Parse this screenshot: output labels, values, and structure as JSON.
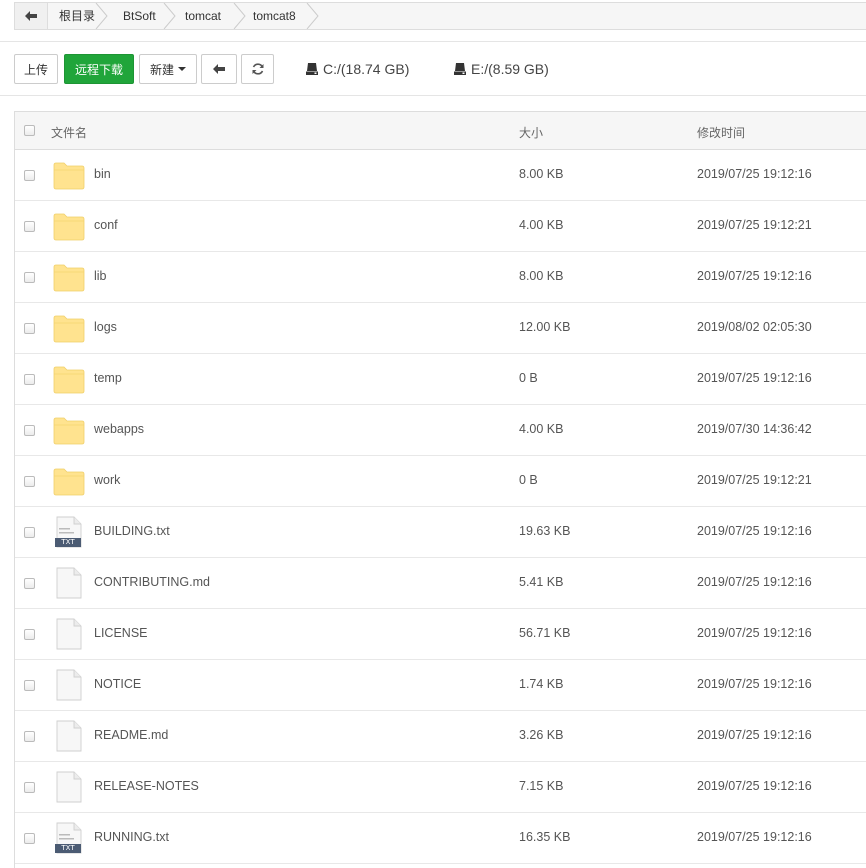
{
  "breadcrumb": {
    "items": [
      "根目录",
      "BtSoft",
      "tomcat",
      "tomcat8"
    ]
  },
  "toolbar": {
    "upload_label": "上传",
    "remote_download_label": "远程下载",
    "new_label": "新建",
    "disks": [
      {
        "label": "C:/(18.74 GB)"
      },
      {
        "label": "E:/(8.59 GB)"
      }
    ]
  },
  "table": {
    "headers": {
      "name": "文件名",
      "size": "大小",
      "mtime": "修改时间"
    },
    "rows": [
      {
        "type": "folder",
        "name": "bin",
        "size": "8.00 KB",
        "mtime": "2019/07/25 19:12:16"
      },
      {
        "type": "folder",
        "name": "conf",
        "size": "4.00 KB",
        "mtime": "2019/07/25 19:12:21"
      },
      {
        "type": "folder",
        "name": "lib",
        "size": "8.00 KB",
        "mtime": "2019/07/25 19:12:16"
      },
      {
        "type": "folder",
        "name": "logs",
        "size": "12.00 KB",
        "mtime": "2019/08/02 02:05:30"
      },
      {
        "type": "folder",
        "name": "temp",
        "size": "0 B",
        "mtime": "2019/07/25 19:12:16"
      },
      {
        "type": "folder",
        "name": "webapps",
        "size": "4.00 KB",
        "mtime": "2019/07/30 14:36:42"
      },
      {
        "type": "folder",
        "name": "work",
        "size": "0 B",
        "mtime": "2019/07/25 19:12:21"
      },
      {
        "type": "txt",
        "name": "BUILDING.txt",
        "size": "19.63 KB",
        "mtime": "2019/07/25 19:12:16"
      },
      {
        "type": "file",
        "name": "CONTRIBUTING.md",
        "size": "5.41 KB",
        "mtime": "2019/07/25 19:12:16"
      },
      {
        "type": "file",
        "name": "LICENSE",
        "size": "56.71 KB",
        "mtime": "2019/07/25 19:12:16"
      },
      {
        "type": "file",
        "name": "NOTICE",
        "size": "1.74 KB",
        "mtime": "2019/07/25 19:12:16"
      },
      {
        "type": "file",
        "name": "README.md",
        "size": "3.26 KB",
        "mtime": "2019/07/25 19:12:16"
      },
      {
        "type": "file",
        "name": "RELEASE-NOTES",
        "size": "7.15 KB",
        "mtime": "2019/07/25 19:12:16"
      },
      {
        "type": "txt",
        "name": "RUNNING.txt",
        "size": "16.35 KB",
        "mtime": "2019/07/25 19:12:16"
      }
    ]
  },
  "icons": {
    "back": "arrow-left-icon",
    "refresh": "refresh-icon",
    "disk": "hard-drive-icon",
    "folder": "folder-icon",
    "file": "file-icon",
    "txt": "txt-file-icon",
    "txt_badge": "TXT"
  },
  "colors": {
    "accent": "#20a53a",
    "folder": "#fde68a"
  }
}
